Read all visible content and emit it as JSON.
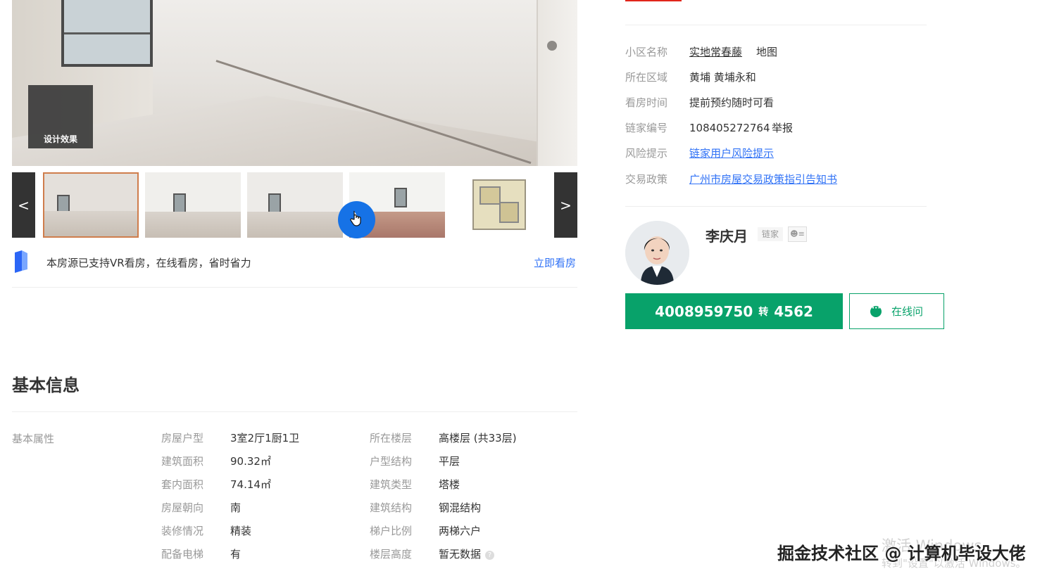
{
  "gallery": {
    "design_badge": "设计效果",
    "prev_label": "<",
    "next_label": ">",
    "thumbnail_count": 5,
    "selected_thumbnail": 1
  },
  "vr": {
    "notice": "本房源已支持VR看房，在线看房，省时省力",
    "link": "立即看房"
  },
  "basic_info": {
    "title": "基本信息",
    "group": "基本属性",
    "left_attrs": [
      {
        "label": "房屋户型",
        "value": "3室2厅1厨1卫"
      },
      {
        "label": "建筑面积",
        "value": "90.32㎡"
      },
      {
        "label": "套内面积",
        "value": "74.14㎡"
      },
      {
        "label": "房屋朝向",
        "value": "南"
      },
      {
        "label": "装修情况",
        "value": "精装"
      },
      {
        "label": "配备电梯",
        "value": "有"
      }
    ],
    "right_attrs": [
      {
        "label": "所在楼层",
        "value": "高楼层 (共33层)"
      },
      {
        "label": "户型结构",
        "value": "平层"
      },
      {
        "label": "建筑类型",
        "value": "塔楼"
      },
      {
        "label": "建筑结构",
        "value": "钢混结构"
      },
      {
        "label": "梯户比例",
        "value": "两梯六户"
      },
      {
        "label": "楼层高度",
        "value": "暂无数据"
      }
    ]
  },
  "overview": {
    "community": {
      "label": "小区名称",
      "value": "实地常春藤",
      "extra": "地图"
    },
    "district": {
      "label": "所在区域",
      "value": "黄埔 黄埔永和"
    },
    "viewing": {
      "label": "看房时间",
      "value": "提前预约随时可看"
    },
    "code": {
      "label": "链家编号",
      "value": "108405272764",
      "extra": "举报"
    },
    "risk": {
      "label": "风险提示",
      "value": "链家用户风险提示"
    },
    "policy": {
      "label": "交易政策",
      "value": "广州市房屋交易政策指引告知书"
    }
  },
  "agent": {
    "name": "李庆月",
    "tag": "链家",
    "phone": "4008959750",
    "phone_sep": "转",
    "extension": "4562",
    "online_button": "在线问"
  },
  "watermarks": {
    "windows_line1": "激活 Windows",
    "windows_line2": "转到\"设置\"以激活 Windows。",
    "juejin": "掘金技术社区 @ 计算机毕设大佬"
  },
  "colors": {
    "accent_green": "#08a26a",
    "link_blue": "#3072f6",
    "cursor_blue": "#1672e6"
  }
}
